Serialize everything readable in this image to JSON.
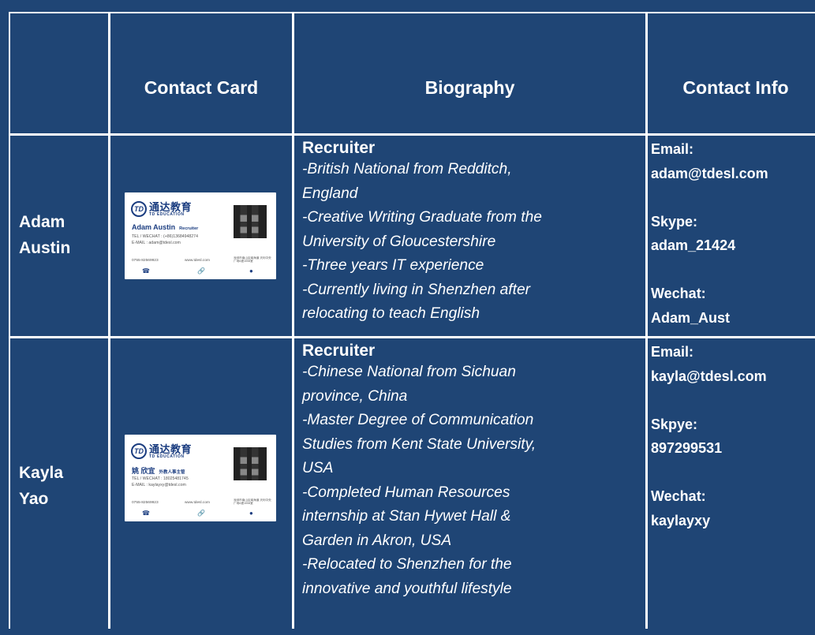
{
  "headers": [
    "",
    "Contact Card",
    "Biography",
    "Contact Info"
  ],
  "people": [
    {
      "name_lines": [
        "Adam",
        "Austin"
      ],
      "card": {
        "logo_mark": "TD",
        "brand_cn": "通达教育",
        "brand_en": "TD EDUCATION",
        "name": "Adam Austin",
        "role": "Recruiter",
        "tel": "TEL / WECHAT : (+86)13684948274",
        "email": "E-MAIL : adam@tdesl.com",
        "phone": "0755-82569923",
        "web": "www.tdesl.com",
        "address": "深圳市南山区南海道 天利中央广场A座1008室"
      },
      "role": "Recruiter",
      "bio_lines": [
        "-British National from Redditch,",
        "England",
        "-Creative Writing Graduate from the",
        "University of Gloucestershire",
        "-Three years IT experience",
        "-Currently living in Shenzhen after",
        "relocating to teach English"
      ],
      "contact": {
        "email_label": "Email:",
        "email": "adam@tdesl.com",
        "skype_label": "Skype:",
        "skype": "adam_21424",
        "wechat_label": "Wechat:",
        "wechat": "Adam_Aust"
      }
    },
    {
      "name_lines": [
        "Kayla",
        "Yao"
      ],
      "card": {
        "logo_mark": "TD",
        "brand_cn": "通达教育",
        "brand_en": "TD EDUCATION",
        "name": "姚 欣宜",
        "role": "外教人事主管",
        "tel": "TEL / WECHAT : 18025481745",
        "email": "E-MAIL : kaylayxy@tdesl.com",
        "phone": "0755-82569923",
        "web": "www.tdesl.com",
        "address": "深圳市南山区南海道 天利中央广场A座1008室"
      },
      "role": "Recruiter",
      "bio_lines": [
        "-Chinese National from Sichuan",
        "province, China",
        "-Master Degree of Communication",
        "Studies from Kent State University,",
        "USA",
        "-Completed Human Resources",
        "internship at Stan Hywet Hall &",
        "Garden in Akron, USA",
        "-Relocated to Shenzhen for the",
        "innovative and youthful lifestyle"
      ],
      "contact": {
        "email_label": "Email:",
        "email": "kayla@tdesl.com",
        "skype_label": "Skpye:",
        "skype": "897299531",
        "wechat_label": "Wechat:",
        "wechat": "kaylayxy"
      }
    }
  ],
  "icons": [
    "phone-icon",
    "link-icon",
    "location-pin-icon"
  ],
  "colors": {
    "background": "#1f4575",
    "text": "#ffffff",
    "grid_line": "#ffffff",
    "card_blue": "#1b3d80"
  }
}
